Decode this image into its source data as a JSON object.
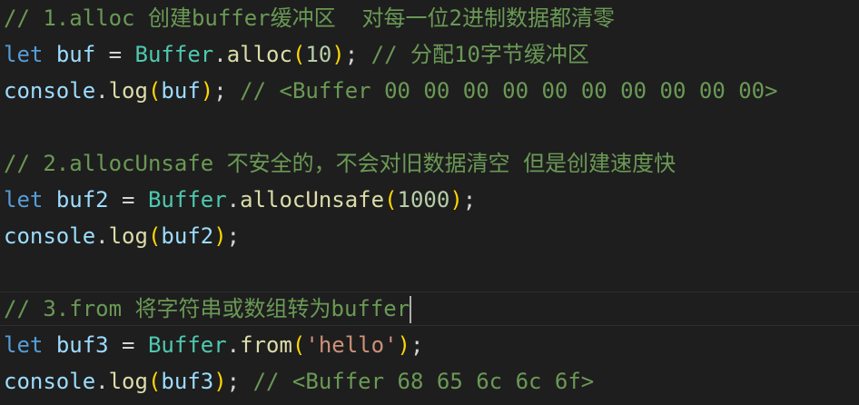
{
  "editor": {
    "theme_colors": {
      "background": "#1e1e1e",
      "comment": "#6a9955",
      "keyword": "#569cd6",
      "variable": "#9cdcfe",
      "class": "#4ec9b0",
      "function": "#dcdcaa",
      "number": "#b5cea8",
      "string": "#ce9178",
      "bracket": "#ffd700",
      "punctuation": "#d4d4d4"
    },
    "lines": [
      {
        "tokens": [
          {
            "t": "comment",
            "v": "// 1.alloc 创建buffer缓冲区  对每一位2进制数据都清零"
          }
        ]
      },
      {
        "tokens": [
          {
            "t": "keyword",
            "v": "let"
          },
          {
            "t": "punct",
            "v": " "
          },
          {
            "t": "variable",
            "v": "buf"
          },
          {
            "t": "punct",
            "v": " = "
          },
          {
            "t": "class",
            "v": "Buffer"
          },
          {
            "t": "punct",
            "v": "."
          },
          {
            "t": "function",
            "v": "alloc"
          },
          {
            "t": "paren",
            "v": "("
          },
          {
            "t": "number",
            "v": "10"
          },
          {
            "t": "paren",
            "v": ")"
          },
          {
            "t": "punct",
            "v": "; "
          },
          {
            "t": "comment",
            "v": "// 分配10字节缓冲区"
          }
        ]
      },
      {
        "tokens": [
          {
            "t": "variable",
            "v": "console"
          },
          {
            "t": "punct",
            "v": "."
          },
          {
            "t": "function",
            "v": "log"
          },
          {
            "t": "paren",
            "v": "("
          },
          {
            "t": "variable",
            "v": "buf"
          },
          {
            "t": "paren",
            "v": ")"
          },
          {
            "t": "punct",
            "v": "; "
          },
          {
            "t": "comment",
            "v": "// <Buffer 00 00 00 00 00 00 00 00 00 00>"
          }
        ]
      },
      {
        "tokens": []
      },
      {
        "tokens": [
          {
            "t": "comment",
            "v": "// 2.allocUnsafe 不安全的，不会对旧数据清空 但是创建速度快"
          }
        ]
      },
      {
        "tokens": [
          {
            "t": "keyword",
            "v": "let"
          },
          {
            "t": "punct",
            "v": " "
          },
          {
            "t": "variable",
            "v": "buf2"
          },
          {
            "t": "punct",
            "v": " = "
          },
          {
            "t": "class",
            "v": "Buffer"
          },
          {
            "t": "punct",
            "v": "."
          },
          {
            "t": "function",
            "v": "allocUnsafe"
          },
          {
            "t": "paren",
            "v": "("
          },
          {
            "t": "number",
            "v": "1000"
          },
          {
            "t": "paren",
            "v": ")"
          },
          {
            "t": "punct",
            "v": ";"
          }
        ]
      },
      {
        "tokens": [
          {
            "t": "variable",
            "v": "console"
          },
          {
            "t": "punct",
            "v": "."
          },
          {
            "t": "function",
            "v": "log"
          },
          {
            "t": "paren",
            "v": "("
          },
          {
            "t": "variable",
            "v": "buf2"
          },
          {
            "t": "paren",
            "v": ")"
          },
          {
            "t": "punct",
            "v": ";"
          }
        ]
      },
      {
        "tokens": []
      },
      {
        "tokens": [
          {
            "t": "comment",
            "v": "// 3.from 将字符串或数组转为buffer"
          }
        ],
        "cursor": true
      },
      {
        "tokens": [
          {
            "t": "keyword",
            "v": "let"
          },
          {
            "t": "punct",
            "v": " "
          },
          {
            "t": "variable",
            "v": "buf3"
          },
          {
            "t": "punct",
            "v": " = "
          },
          {
            "t": "class",
            "v": "Buffer"
          },
          {
            "t": "punct",
            "v": "."
          },
          {
            "t": "function",
            "v": "from"
          },
          {
            "t": "paren",
            "v": "("
          },
          {
            "t": "string",
            "v": "'hello'"
          },
          {
            "t": "paren",
            "v": ")"
          },
          {
            "t": "punct",
            "v": ";"
          }
        ]
      },
      {
        "tokens": [
          {
            "t": "variable",
            "v": "console"
          },
          {
            "t": "punct",
            "v": "."
          },
          {
            "t": "function",
            "v": "log"
          },
          {
            "t": "paren",
            "v": "("
          },
          {
            "t": "variable",
            "v": "buf3"
          },
          {
            "t": "paren",
            "v": ")"
          },
          {
            "t": "punct",
            "v": "; "
          },
          {
            "t": "comment",
            "v": "// <Buffer 68 65 6c 6c 6f>"
          }
        ]
      }
    ]
  }
}
